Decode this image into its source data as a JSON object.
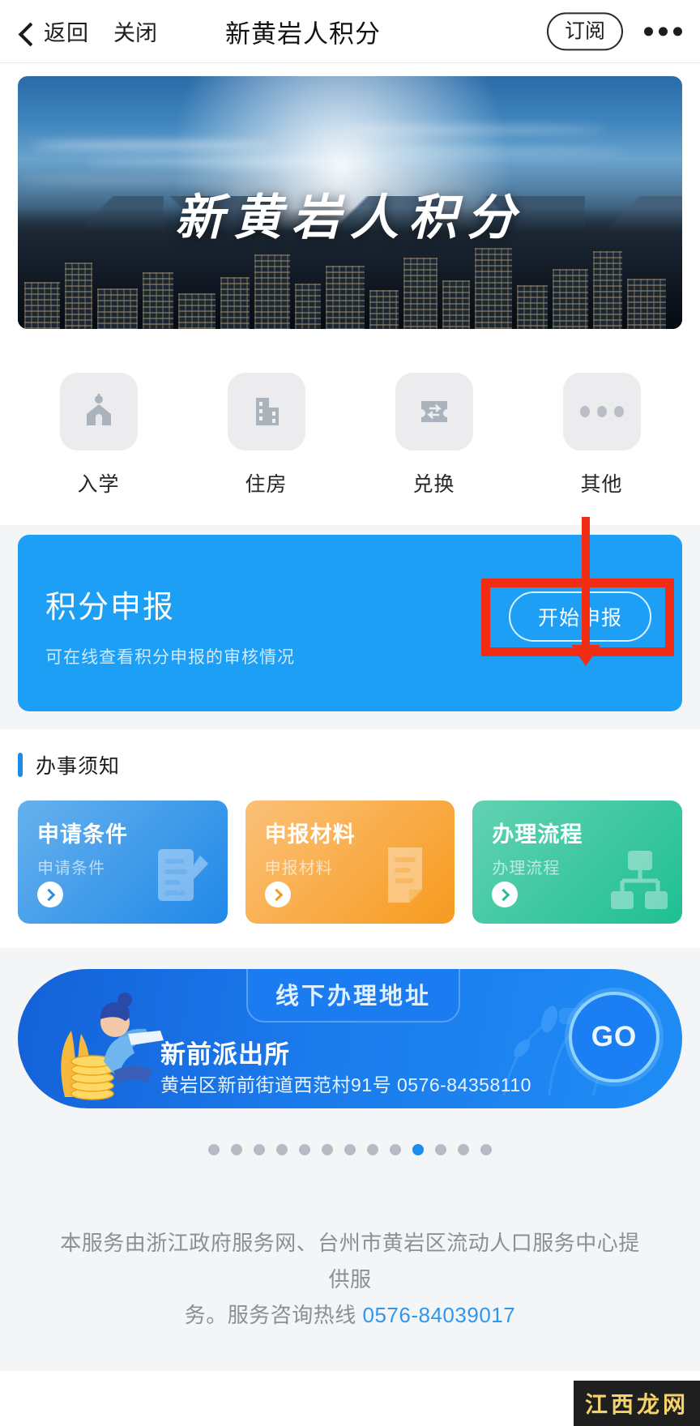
{
  "header": {
    "back_label": "返回",
    "close_label": "关闭",
    "title": "新黄岩人积分",
    "subscribe_label": "订阅",
    "more_icon": "more-horizontal-icon"
  },
  "banner": {
    "title": "新黄岩人积分",
    "image_desc": "huangyan-city-skyline"
  },
  "quicknav": [
    {
      "label": "入学",
      "icon": "school-icon"
    },
    {
      "label": "住房",
      "icon": "building-icon"
    },
    {
      "label": "兑换",
      "icon": "exchange-ticket-icon"
    },
    {
      "label": "其他",
      "icon": "more-dots-icon"
    }
  ],
  "declare": {
    "title": "积分申报",
    "subtitle": "可在线查看积分申报的审核情况",
    "button_label": "开始申报",
    "accent_color": "#1c9ff5",
    "highlight_color": "#f02d12"
  },
  "notice": {
    "section_title": "办事须知",
    "cards": [
      {
        "title": "申请条件",
        "subtitle": "申请条件",
        "color": "#2088e8",
        "icon": "document-pen-icon"
      },
      {
        "title": "申报材料",
        "subtitle": "申报材料",
        "color": "#f79a1e",
        "icon": "document-icon"
      },
      {
        "title": "办理流程",
        "subtitle": "办理流程",
        "color": "#1fbf93",
        "icon": "flowchart-icon"
      }
    ]
  },
  "address": {
    "pill_label": "线下办理地址",
    "name": "新前派出所",
    "detail": "黄岩区新前街道西范村91号 0576-84358110",
    "go_label": "GO"
  },
  "carousel": {
    "total": 13,
    "active_index": 9
  },
  "footer": {
    "line_1": "本服务由浙江政府服务网、台州市黄岩区流动人口服务中心提供服",
    "line_2_prefix": "务。服务咨询热线 ",
    "phone": "0576-84039017"
  },
  "watermark": {
    "text": "江西龙网"
  }
}
